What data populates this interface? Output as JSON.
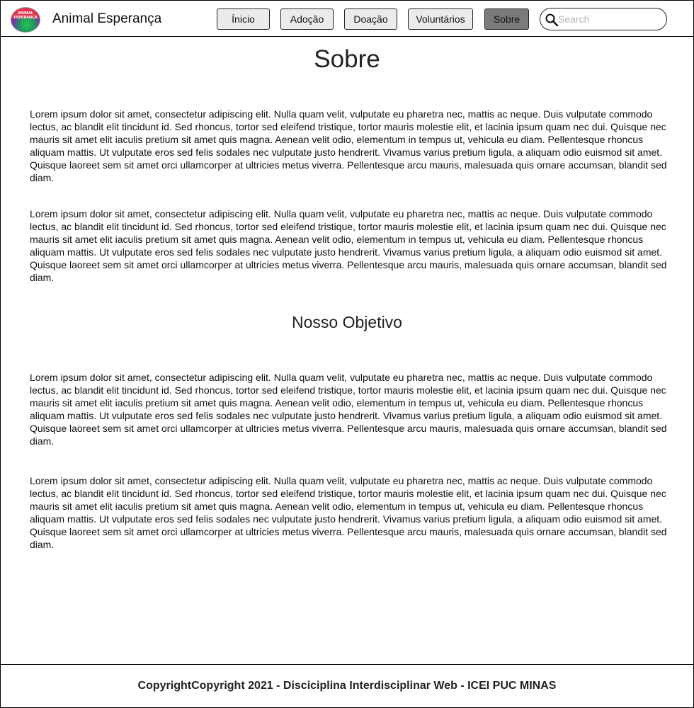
{
  "header": {
    "brand": "Animal Esperança",
    "logo_text": "ANIMAL ESPERANÇA",
    "nav": [
      {
        "label": "Ínicio"
      },
      {
        "label": "Adoção"
      },
      {
        "label": "Doação"
      },
      {
        "label": "Voluntários"
      },
      {
        "label": "Sobre",
        "active": true
      }
    ],
    "search": {
      "placeholder": "Search",
      "value": ""
    }
  },
  "main": {
    "title": "Sobre",
    "paragraphs_top": [
      "Lorem ipsum dolor sit amet, consectetur adipiscing elit. Nulla quam velit, vulputate eu pharetra nec, mattis ac neque. Duis vulputate commodo lectus, ac blandit elit tincidunt id. Sed rhoncus, tortor sed eleifend tristique, tortor mauris molestie elit, et lacinia ipsum quam nec dui. Quisque nec mauris sit amet elit iaculis pretium sit amet quis magna. Aenean velit odio, elementum in tempus ut, vehicula eu diam. Pellentesque rhoncus aliquam mattis. Ut vulputate eros sed felis sodales nec vulputate justo hendrerit. Vivamus varius pretium ligula, a aliquam odio euismod sit amet. Quisque laoreet sem sit amet orci ullamcorper at ultricies metus viverra. Pellentesque arcu mauris, malesuada quis ornare accumsan, blandit sed diam.",
      "Lorem ipsum dolor sit amet, consectetur adipiscing elit. Nulla quam velit, vulputate eu pharetra nec, mattis ac neque. Duis vulputate commodo lectus, ac blandit elit tincidunt id. Sed rhoncus, tortor sed eleifend tristique, tortor mauris molestie elit, et lacinia ipsum quam nec dui. Quisque nec mauris sit amet elit iaculis pretium sit amet quis magna. Aenean velit odio, elementum in tempus ut, vehicula eu diam. Pellentesque rhoncus aliquam mattis. Ut vulputate eros sed felis sodales nec vulputate justo hendrerit. Vivamus varius pretium ligula, a aliquam odio euismod sit amet. Quisque laoreet sem sit amet orci ullamcorper at ultricies metus viverra. Pellentesque arcu mauris, malesuada quis ornare accumsan, blandit sed diam."
    ],
    "section_title": "Nosso Objetivo",
    "paragraphs_bottom": [
      "Lorem ipsum dolor sit amet, consectetur adipiscing elit. Nulla quam velit, vulputate eu pharetra nec, mattis ac neque. Duis vulputate commodo lectus, ac blandit elit tincidunt id. Sed rhoncus, tortor sed eleifend tristique, tortor mauris molestie elit, et lacinia ipsum quam nec dui. Quisque nec mauris sit amet elit iaculis pretium sit amet quis magna. Aenean velit odio, elementum in tempus ut, vehicula eu diam. Pellentesque rhoncus aliquam mattis. Ut vulputate eros sed felis sodales nec vulputate justo hendrerit. Vivamus varius pretium ligula, a aliquam odio euismod sit amet. Quisque laoreet sem sit amet orci ullamcorper at ultricies metus viverra. Pellentesque arcu mauris, malesuada quis ornare accumsan, blandit sed diam.",
      "Lorem ipsum dolor sit amet, consectetur adipiscing elit. Nulla quam velit, vulputate eu pharetra nec, mattis ac neque. Duis vulputate commodo lectus, ac blandit elit tincidunt id. Sed rhoncus, tortor sed eleifend tristique, tortor mauris molestie elit, et lacinia ipsum quam nec dui. Quisque nec mauris sit amet elit iaculis pretium sit amet quis magna. Aenean velit odio, elementum in tempus ut, vehicula eu diam. Pellentesque rhoncus aliquam mattis. Ut vulputate eros sed felis sodales nec vulputate justo hendrerit. Vivamus varius pretium ligula, a aliquam odio euismod sit amet. Quisque laoreet sem sit amet orci ullamcorper at ultricies metus viverra. Pellentesque arcu mauris, malesuada quis ornare accumsan, blandit sed diam."
    ]
  },
  "footer": {
    "text": "CopyrightCopyright 2021 - Disciciplina Interdisciplinar Web - ICEI PUC MINAS"
  },
  "icons": {
    "search": "search-icon",
    "logo": "logo-icon"
  },
  "colors": {
    "active_button": "#7b7b7b",
    "button": "#ebebeb"
  }
}
